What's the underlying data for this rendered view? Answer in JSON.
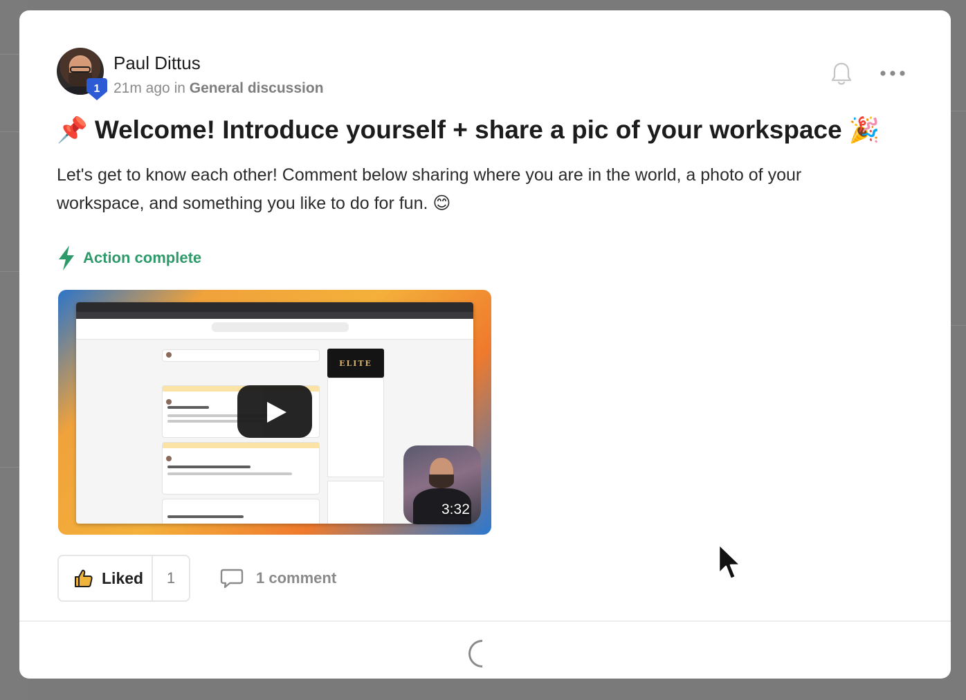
{
  "post": {
    "author": "Paul Dittus",
    "author_level": "1",
    "time_ago": "21m ago",
    "in_label": "in",
    "category": "General discussion",
    "title_emoji_start": "📌",
    "title": "Welcome! Introduce yourself + share a pic of your workspace",
    "title_emoji_end": "🎉",
    "body": "Let's get to know each other! Comment below sharing where you are in the world, a photo of your workspace, and something you like to do for fun. 😊",
    "action_status": "Action complete",
    "video": {
      "duration": "3:32",
      "embedded_logo": "ELITE"
    },
    "like": {
      "label": "Liked",
      "count": "1"
    },
    "comments": {
      "label": "1 comment"
    }
  },
  "icons": {
    "notification": "bell-icon",
    "more": "more-options-icon",
    "action": "lightning-bolt-icon",
    "like": "thumbs-up-icon",
    "comment": "comment-bubble-icon",
    "loading": "spinner-icon",
    "cursor": "mouse-pointer-icon"
  },
  "colors": {
    "accent_green": "#2e9a6a",
    "badge_blue": "#2d5bd6",
    "modal_bg": "#ffffff",
    "overlay_bg": "#7a7a7a"
  }
}
